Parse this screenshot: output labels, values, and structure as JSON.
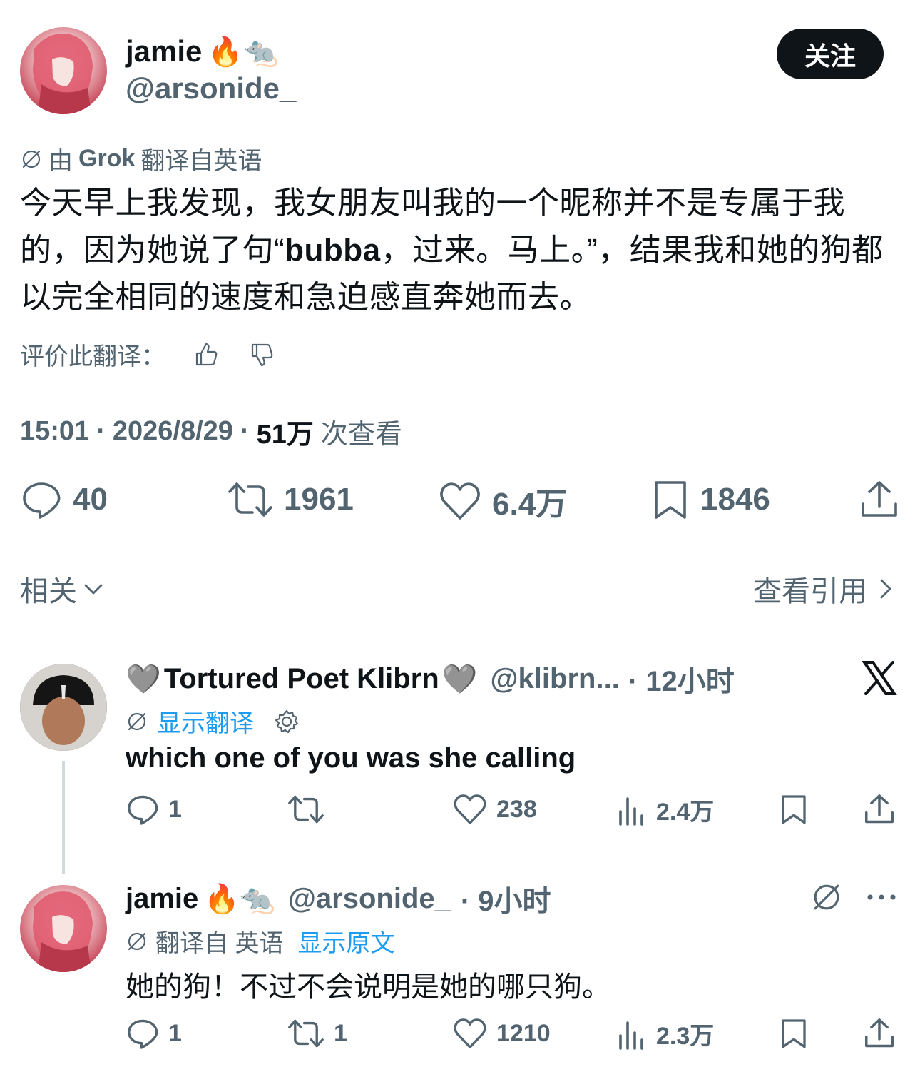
{
  "main_tweet": {
    "author": {
      "display_name": "jamie",
      "emojis": "🔥🐀",
      "handle": "@arsonide_"
    },
    "follow_label": "关注",
    "translation_note": {
      "prefix": "由",
      "grok": "Grok",
      "suffix": "翻译自英语"
    },
    "text_parts": [
      "今天早上我发现，我女朋友叫我的一个昵称并不是专属于我的，因为她说了句“",
      "bubba",
      "，过来。马上。”，结果我和她的狗都以完全相同的速度和急迫感直奔她而去。"
    ],
    "rate_label": "评价此翻译：",
    "meta": {
      "time": "15:01",
      "sep1": "·",
      "date": "2026/8/29",
      "sep2": "·",
      "views_count": "51万",
      "views_label": "次查看"
    },
    "stats": {
      "replies": "40",
      "retweets": "1961",
      "likes": "6.4万",
      "bookmarks": "1846"
    },
    "related_label": "相关",
    "quotes_label": "查看引用"
  },
  "replies": [
    {
      "heart_l": "🩶",
      "display_name": "Tortured Poet Klibrn",
      "heart_r": "🩶",
      "handle": "@klibrn...",
      "time": "· 12小时",
      "show_translation": "显示翻译",
      "text": "which one of you was she calling",
      "stats": {
        "replies": "1",
        "retweets": "",
        "likes": "238",
        "views": "2.4万"
      }
    },
    {
      "display_name": "jamie",
      "emojis": "🔥🐀",
      "handle": "@arsonide_",
      "time": "· 9小时",
      "translated_from": "翻译自 英语",
      "show_original": "显示原文",
      "text": "她的狗！不过不会说明是她的哪只狗。",
      "stats": {
        "replies": "1",
        "retweets": "1",
        "likes": "1210",
        "views": "2.3万"
      }
    }
  ],
  "icons": {
    "reply": "speech-bubble-icon",
    "retweet": "retweet-icon",
    "like": "heart-icon",
    "bookmark": "bookmark-icon",
    "share": "share-icon",
    "views": "bar-chart-icon",
    "translate": "slashed-circle-icon",
    "settings": "gear-icon",
    "more": "ellipsis-icon",
    "x_logo": "x-logo-icon"
  },
  "colors": {
    "link": "#1d9bf0",
    "muted": "#536471",
    "text": "#0f1419"
  }
}
